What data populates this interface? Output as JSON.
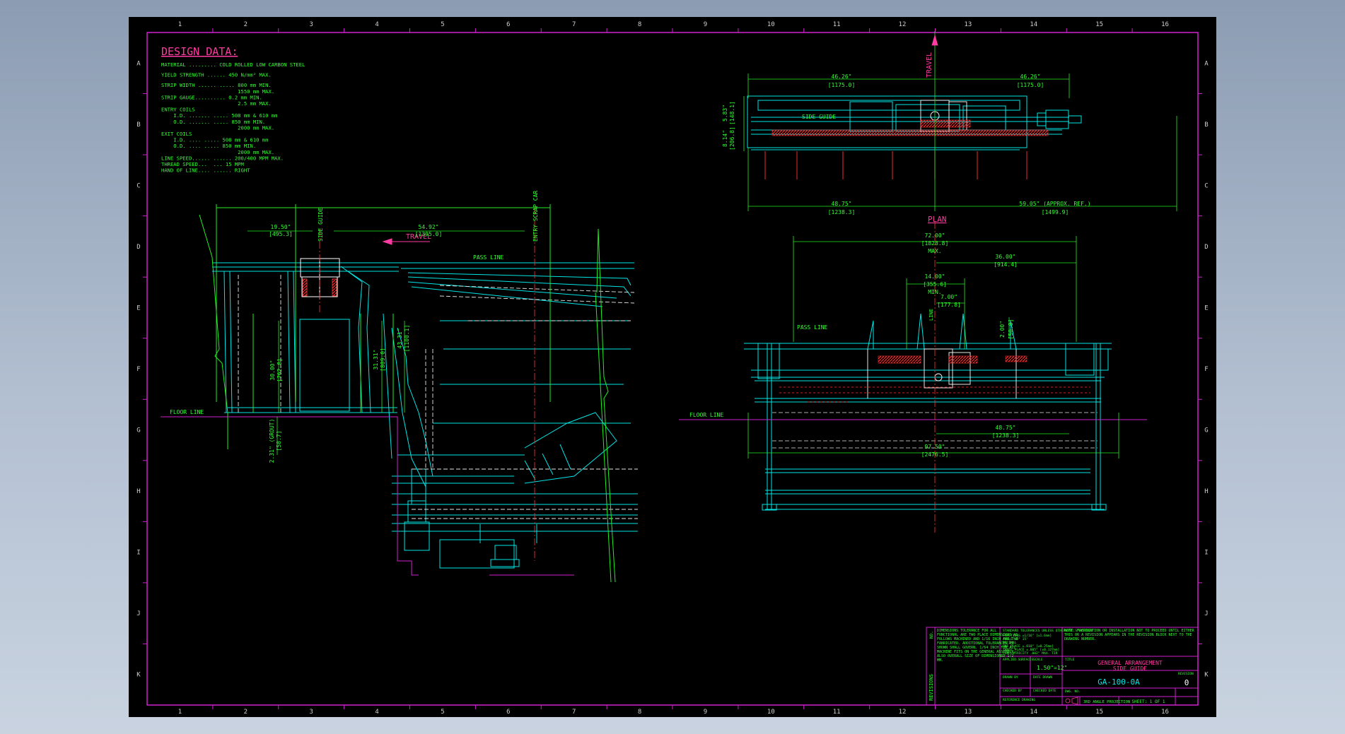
{
  "zone_columns": [
    "1",
    "2",
    "3",
    "4",
    "5",
    "6",
    "7",
    "8",
    "9",
    "10",
    "11",
    "12",
    "13",
    "14",
    "15",
    "16"
  ],
  "zone_rows": [
    "A",
    "B",
    "C",
    "D",
    "E",
    "F",
    "G",
    "H",
    "I",
    "J",
    "K"
  ],
  "design_data": {
    "title": "DESIGN DATA:",
    "lines": [
      "MATERIAL ......... COLD ROLLED LOW CARBON STEEL",
      "",
      "YIELD STRENGTH ...... 450 N/mm² MAX.",
      "",
      "STRIP WIDTH ...... ..... 800 mm MIN.",
      "                         1550 mm MAX.",
      "STRIP GAUGE.......... 0.2 mm MIN.",
      "                         2.5 mm MAX.",
      "ENTRY COILS",
      "    I.D. ....... ..... 508 mm & 610 mm",
      "    O.D. ....... ..... 850 mm MIN.",
      "                         2000 mm MAX.",
      "EXIT COILS",
      "    I.D. .... ..... 508 mm & 610 mm",
      "    O.D. .... ..... 850 mm MIN.",
      "                         2000 mm MAX.",
      "LINE SPEED...... ...... 200/400 MPM MAX.",
      "THREAD SPEED...  ... 15 MPM",
      "HAND OF LINE.... ...... RIGHT"
    ]
  },
  "labels": {
    "travel": "TRAVEL",
    "side_guide": "SIDE GUIDE",
    "entry_scrap_car": "ENTRY SCRAP CAR",
    "pass_line": "PASS LINE",
    "floor_line": "FLOOR LINE",
    "plan": "PLAN",
    "max": "MAX.",
    "min": "MIN.",
    "line": "LINE"
  },
  "side_dims": {
    "d1": "19.50\"",
    "d1m": "[495.3]",
    "d2": "54.92\"",
    "d2m": "[1395.0]",
    "d3": "30.00\"",
    "d3m": "[762.0]",
    "d4": "31.31\"",
    "d4m": "[809.0]",
    "d5": "43.31\"",
    "d5m": "[1100.1]",
    "d6": "2.31\" (GROUT)",
    "d6m": "[58.7]"
  },
  "plan_dims": {
    "p1": "46.26\"",
    "p1m": "[1175.0]",
    "p2": "46.26\"",
    "p2m": "[1175.0]",
    "p3": "48.75\"",
    "p3m": "[1238.3]",
    "p4": "59.05\" (APPROX. REF.)",
    "p4m": "[1499.9]",
    "p5": "5.83\"",
    "p5m": "[148.1]",
    "p6": "8.14\"",
    "p6m": "[206.8]"
  },
  "elev_dims": {
    "e1": "72.00\"",
    "e1m": "[1828.8]",
    "e2": "36.00\"",
    "e2m": "[914.4]",
    "e3": "14.00\"",
    "e3m": "[355.6]",
    "e4": "7.00\"",
    "e4m": "[177.8]",
    "e5": "2.00\"",
    "e5m": "[50.8]",
    "e6": "48.75\"",
    "e6m": "[1238.3]",
    "e7": "97.50\"",
    "e7m": "[2476.5]"
  },
  "title_block": {
    "revisions_label": "REVISIONS",
    "no_label": "NO.",
    "note_left": "DIMENSIONS TOLERANCE FOR ALL FUNCTIONAL ARE TWO PLACE DIMENSIONS AS FOLLOWS MACHINED AND 1/16 INCH FOR THE FABRICATED. ADDITIONAL TOLERANCES AS SHOWN SHALL GOVERN. 1/64 INCH FOR ALL MACHINE FITS ON THE GENERAL ASSEMBLY. ALSO OVERALL SIZE OF DIMENSIONED 1/2 MM.",
    "tolerances_title": "STANDARD TOLERANCES UNLESS OTHERWISE SPECIFIED",
    "tolerances": [
      "FRACTIONS  ±1/16\"  [±1.6mm]",
      "ANGLE  ±0° 15'",
      "DECIMAL",
      "ONE PLACE  ±.010\" [±0.25mm]",
      "THREE PLACE  ±.005\" [±0.127mm]",
      "CONCENTRICITY .002\" MAX. TIR"
    ],
    "note_right": "NOTE: FABRICATION OR INSTALLATION NOT TO PROCEED UNTIL EITHER THIS OR A REVISION APPEARS IN THE REVISION BLOCK NEXT TO THE DRAWING NUMBER.",
    "applied_surfaces": "APPLIED SURFACES",
    "scale_label": "SCALE",
    "scale_value": "1.50\"=12\"",
    "drawn_by": "DRAWN BY",
    "date_drawn": "DATE DRAWN",
    "checked_by": "CHECKED BY",
    "checked_date": "CHECKED DATE",
    "reference_drawing": "REFERENCE DRAWING",
    "title_label": "TITLE",
    "title_line1": "GENERAL ARRANGEMENT",
    "title_line2": "SIDE GUIDE",
    "dwg_no_label": "DWG. NO.",
    "dwg_no": "GA-100-0A",
    "revision_label": "REVISION",
    "revision": "0",
    "projection": "3RD ANGLE PROJECTION",
    "sheet": "SHEET: 1 OF 1"
  },
  "colors": {
    "background": "#000000",
    "border": "#d020d0",
    "dimension": "#22ee22",
    "structure": "#00e5e5",
    "hidden": "#ffffff",
    "centerline": "#ff3333",
    "text_green": "#33ff33"
  }
}
